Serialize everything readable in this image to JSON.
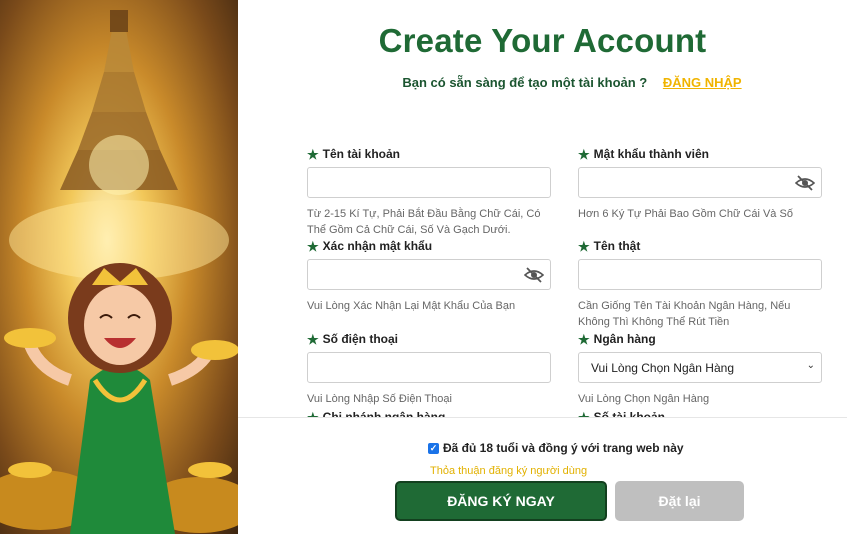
{
  "title": "Create Your Account",
  "subtitle": {
    "question": "Bạn có sẵn sàng để tạo một tài khoản ?",
    "login_link": "ĐĂNG NHẬP"
  },
  "fields": {
    "username": {
      "label": "Tên tài khoản",
      "value": "",
      "help": "Từ 2-15 Kí Tự, Phải Bắt Đầu Bằng Chữ Cái, Có Thể Gồm Cả Chữ Cái, Số Và Gạch Dưới."
    },
    "password": {
      "label": "Mật khẩu thành viên",
      "value": "",
      "help": "Hơn 6 Ký Tự Phải Bao Gồm Chữ Cái Và Số"
    },
    "confirm_password": {
      "label": "Xác nhận mật khẩu",
      "value": "",
      "help": "Vui Lòng Xác Nhận Lại Mật Khẩu Của Bạn"
    },
    "real_name": {
      "label": "Tên thật",
      "value": "",
      "help": "Cần Giống Tên Tài Khoản Ngân Hàng, Nếu Không Thì Không Thể Rút Tiền"
    },
    "phone": {
      "label": "Số điện thoại",
      "value": "",
      "help": "Vui Lòng Nhập Số Điện Thoại"
    },
    "bank": {
      "label": "Ngân hàng",
      "selected": "Vui Lòng Chọn Ngân Hàng",
      "help": "Vui Lòng Chọn Ngân Hàng"
    },
    "branch": {
      "label": "Chi nhánh ngân hàng"
    },
    "account_number": {
      "label": "Số tài khoản"
    }
  },
  "agreement": {
    "checked": true,
    "text": "Đã đủ 18 tuổi và đồng ý với trang web này",
    "terms_link": "Thỏa thuận đăng ký người dùng"
  },
  "buttons": {
    "register": "ĐĂNG KÝ NGAY",
    "reset": "Đặt lại"
  },
  "colors": {
    "brand_green": "#1f6a35",
    "accent_gold": "#f0b400",
    "reset_gray": "#bfbfbf"
  },
  "icons": {
    "required": "star-icon",
    "visibility": "eye-off-icon",
    "dropdown": "chevron-down-icon",
    "checkbox": "check-icon"
  }
}
